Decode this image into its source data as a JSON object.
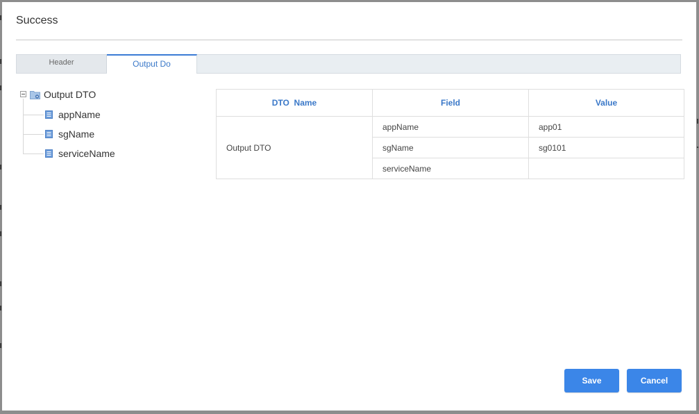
{
  "dialog": {
    "title": "Success"
  },
  "tabs": [
    {
      "label": "Header",
      "active": false
    },
    {
      "label": "Output Do",
      "active": true
    }
  ],
  "tree": {
    "root": {
      "label": "Output DTO",
      "toggle_icon": "collapse-icon",
      "icon": "folder-icon",
      "expanded": true
    },
    "children": [
      {
        "label": "appName",
        "icon": "document-icon"
      },
      {
        "label": "sgName",
        "icon": "document-icon"
      },
      {
        "label": "serviceName",
        "icon": "document-icon"
      }
    ]
  },
  "table": {
    "headers": {
      "dto_name": "DTO  Name",
      "field": "Field",
      "value": "Value"
    },
    "dto_name": "Output DTO",
    "rows": [
      {
        "field": "appName",
        "value": "app01"
      },
      {
        "field": "sgName",
        "value": "sg0101"
      },
      {
        "field": "serviceName",
        "value": ""
      }
    ]
  },
  "buttons": {
    "save": "Save",
    "cancel": "Cancel"
  },
  "colors": {
    "accent": "#3a78c8",
    "button": "#3b86e8",
    "tab_active_border": "#3a7bd5"
  }
}
